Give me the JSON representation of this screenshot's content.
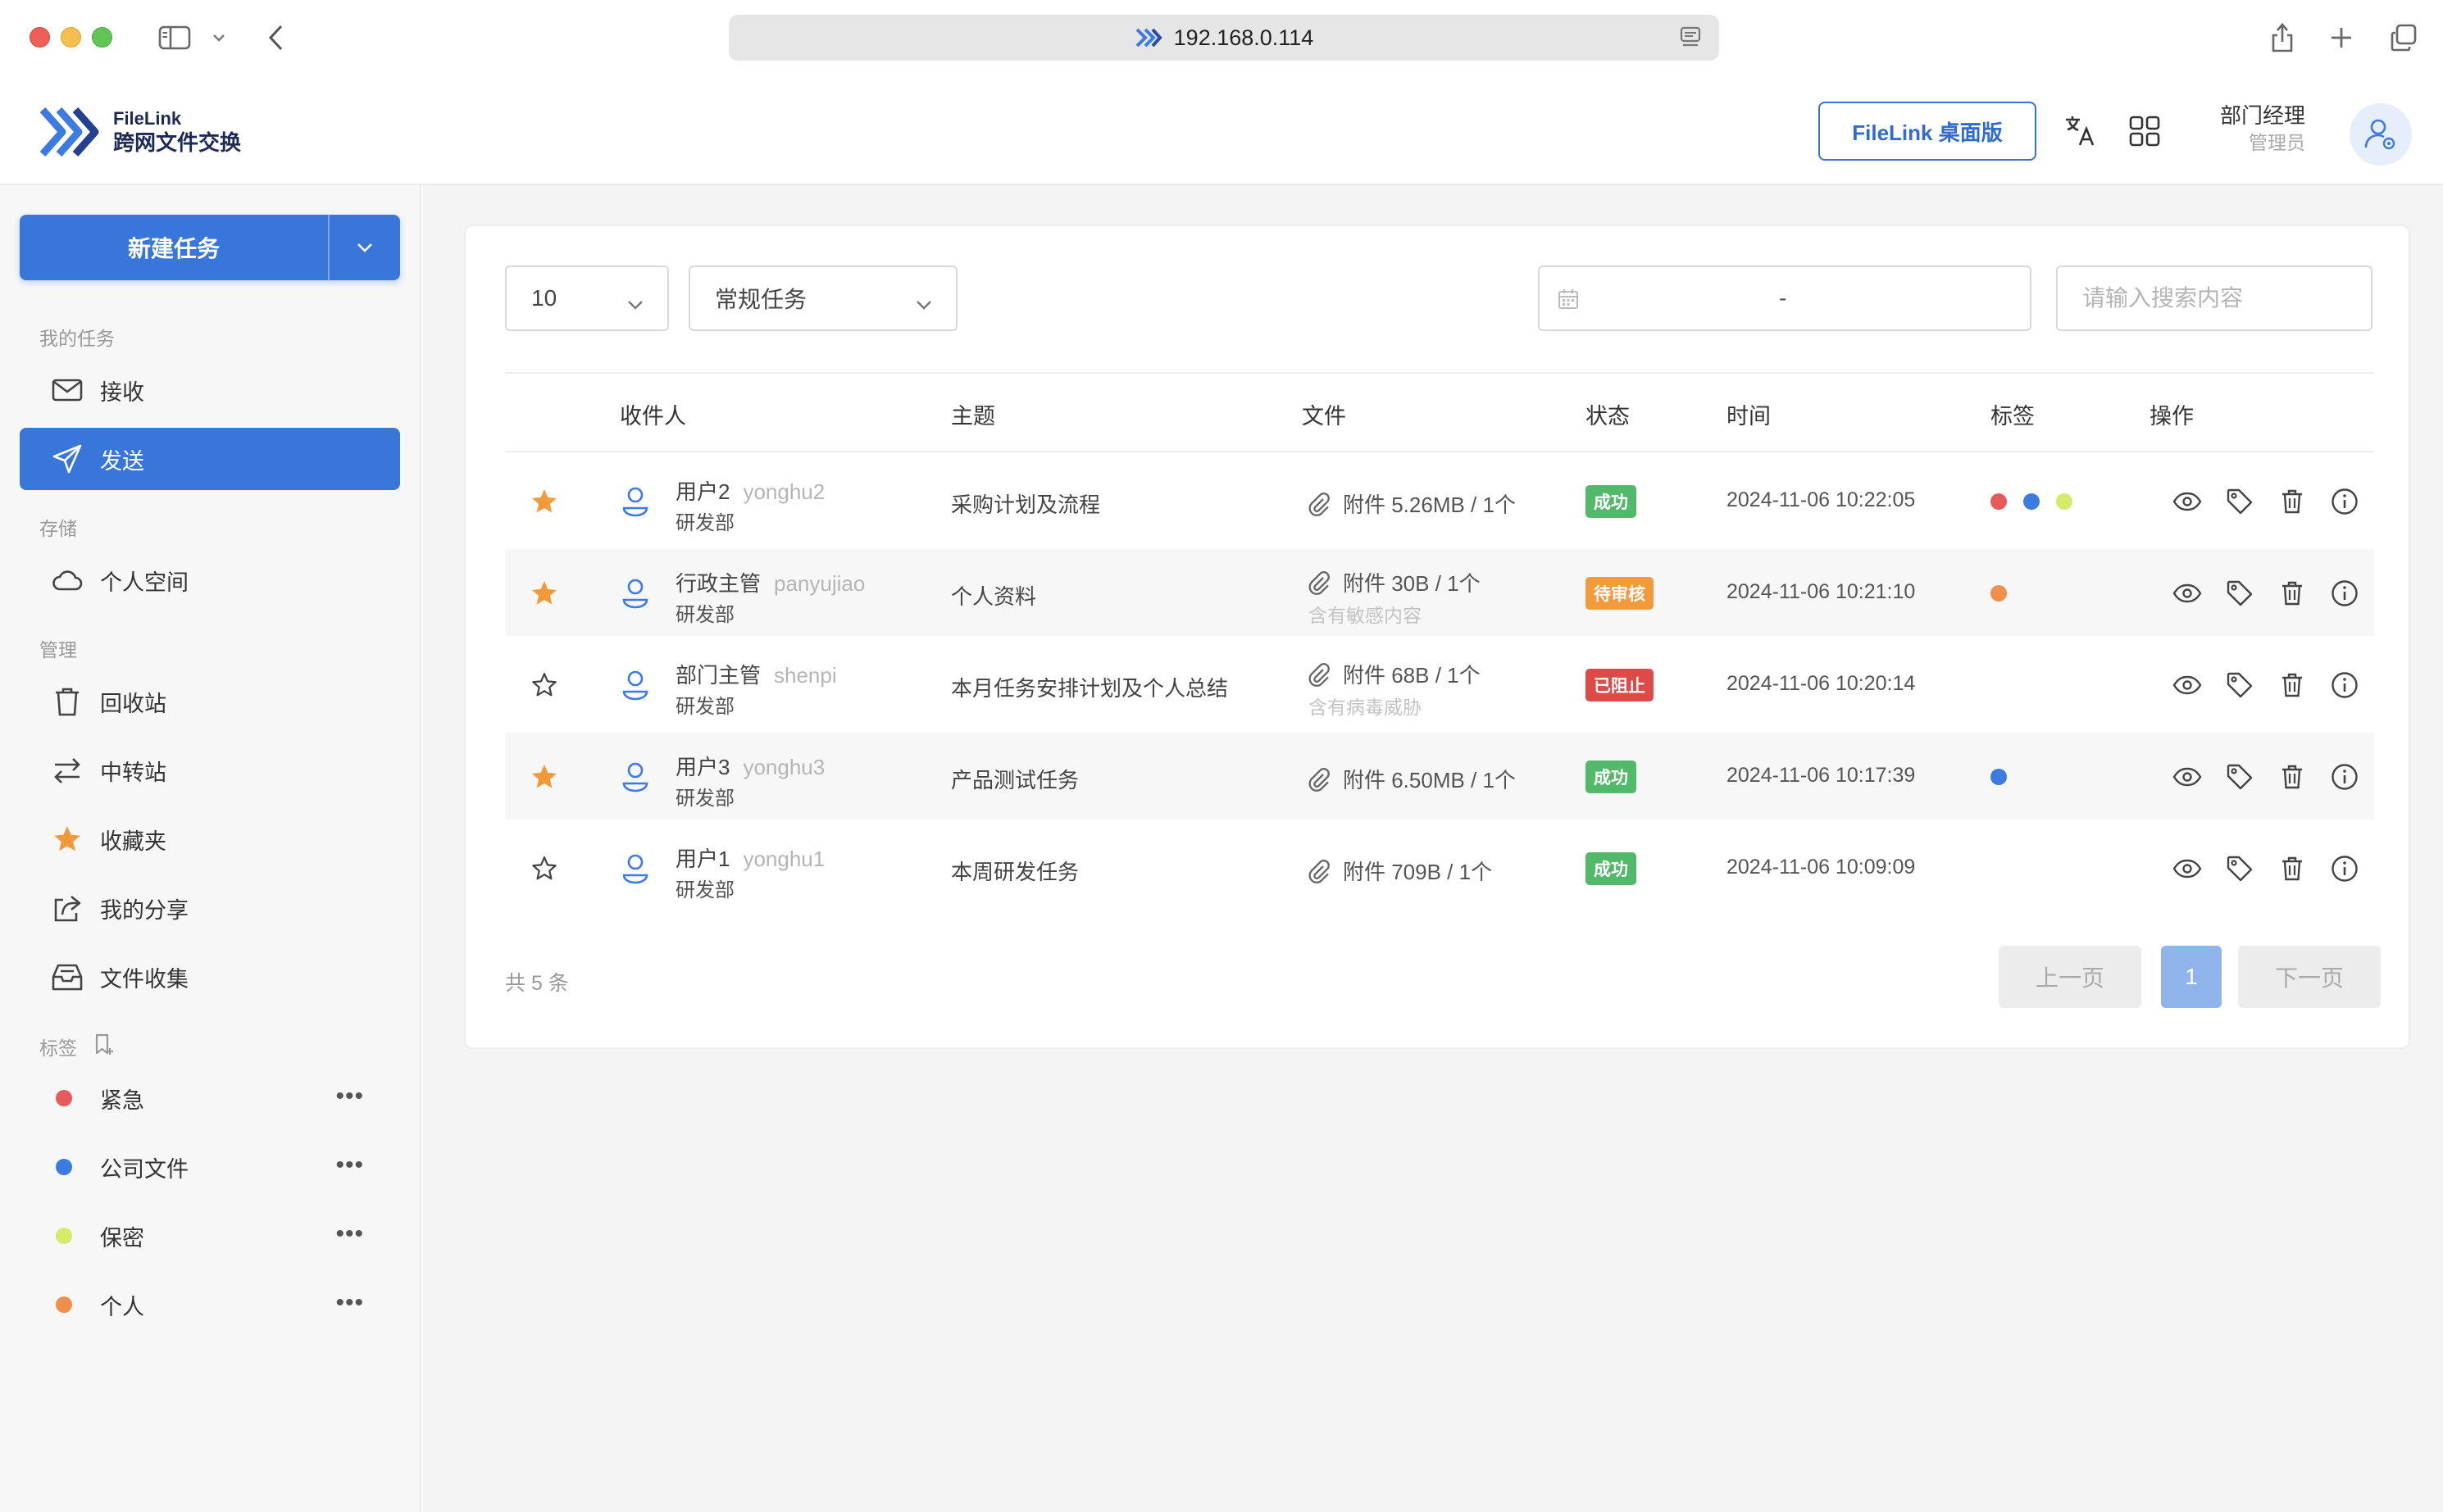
{
  "browser": {
    "url": "192.168.0.114"
  },
  "app": {
    "brand_top": "FileLink",
    "brand_bottom": "跨网文件交换",
    "desktop_button": "FileLink 桌面版",
    "user_name": "部门经理",
    "user_role": "管理员"
  },
  "sidebar": {
    "new_task": "新建任务",
    "section_my_tasks": "我的任务",
    "receive": "接收",
    "send": "发送",
    "section_storage": "存储",
    "personal_space": "个人空间",
    "section_manage": "管理",
    "recycle_bin": "回收站",
    "relay_station": "中转站",
    "favorites": "收藏夹",
    "my_shares": "我的分享",
    "file_collection": "文件收集",
    "section_tags": "标签",
    "tags": [
      {
        "label": "紧急",
        "color": "#e85a5a"
      },
      {
        "label": "公司文件",
        "color": "#3c7be0"
      },
      {
        "label": "保密",
        "color": "#d6ea6c"
      },
      {
        "label": "个人",
        "color": "#ef8f4a"
      }
    ]
  },
  "filters": {
    "page_size": "10",
    "task_type": "常规任务",
    "date_separator": "-",
    "search_placeholder": "请输入搜索内容"
  },
  "table": {
    "headers": {
      "recipient": "收件人",
      "subject": "主题",
      "file": "文件",
      "status": "状态",
      "time": "时间",
      "tags": "标签",
      "actions": "操作"
    },
    "rows": [
      {
        "starred": true,
        "name": "用户2",
        "account": "yonghu2",
        "dept": "研发部",
        "subject": "采购计划及流程",
        "file": "附件 5.26MB / 1个",
        "file_note": "",
        "status": "成功",
        "status_color": "#52b96b",
        "time": "2024-11-06 10:22:05",
        "tag_colors": [
          "#e85a5a",
          "#3c7be0",
          "#d6ea6c"
        ]
      },
      {
        "starred": true,
        "name": "行政主管",
        "account": "panyujiao",
        "dept": "研发部",
        "subject": "个人资料",
        "file": "附件 30B / 1个",
        "file_note": "含有敏感内容",
        "status": "待审核",
        "status_color": "#f39a3a",
        "time": "2024-11-06 10:21:10",
        "tag_colors": [
          "#ef8f4a"
        ]
      },
      {
        "starred": false,
        "name": "部门主管",
        "account": "shenpi",
        "dept": "研发部",
        "subject": "本月任务安排计划及个人总结",
        "file": "附件 68B / 1个",
        "file_note": "含有病毒威胁",
        "status": "已阻止",
        "status_color": "#dd4a48",
        "time": "2024-11-06 10:20:14",
        "tag_colors": []
      },
      {
        "starred": true,
        "name": "用户3",
        "account": "yonghu3",
        "dept": "研发部",
        "subject": "产品测试任务",
        "file": "附件 6.50MB / 1个",
        "file_note": "",
        "status": "成功",
        "status_color": "#52b96b",
        "time": "2024-11-06 10:17:39",
        "tag_colors": [
          "#3c7be0"
        ]
      },
      {
        "starred": false,
        "name": "用户1",
        "account": "yonghu1",
        "dept": "研发部",
        "subject": "本周研发任务",
        "file": "附件 709B / 1个",
        "file_note": "",
        "status": "成功",
        "status_color": "#52b96b",
        "time": "2024-11-06 10:09:09",
        "tag_colors": []
      }
    ]
  },
  "pagination": {
    "total": "共 5 条",
    "prev": "上一页",
    "current": "1",
    "next": "下一页"
  }
}
